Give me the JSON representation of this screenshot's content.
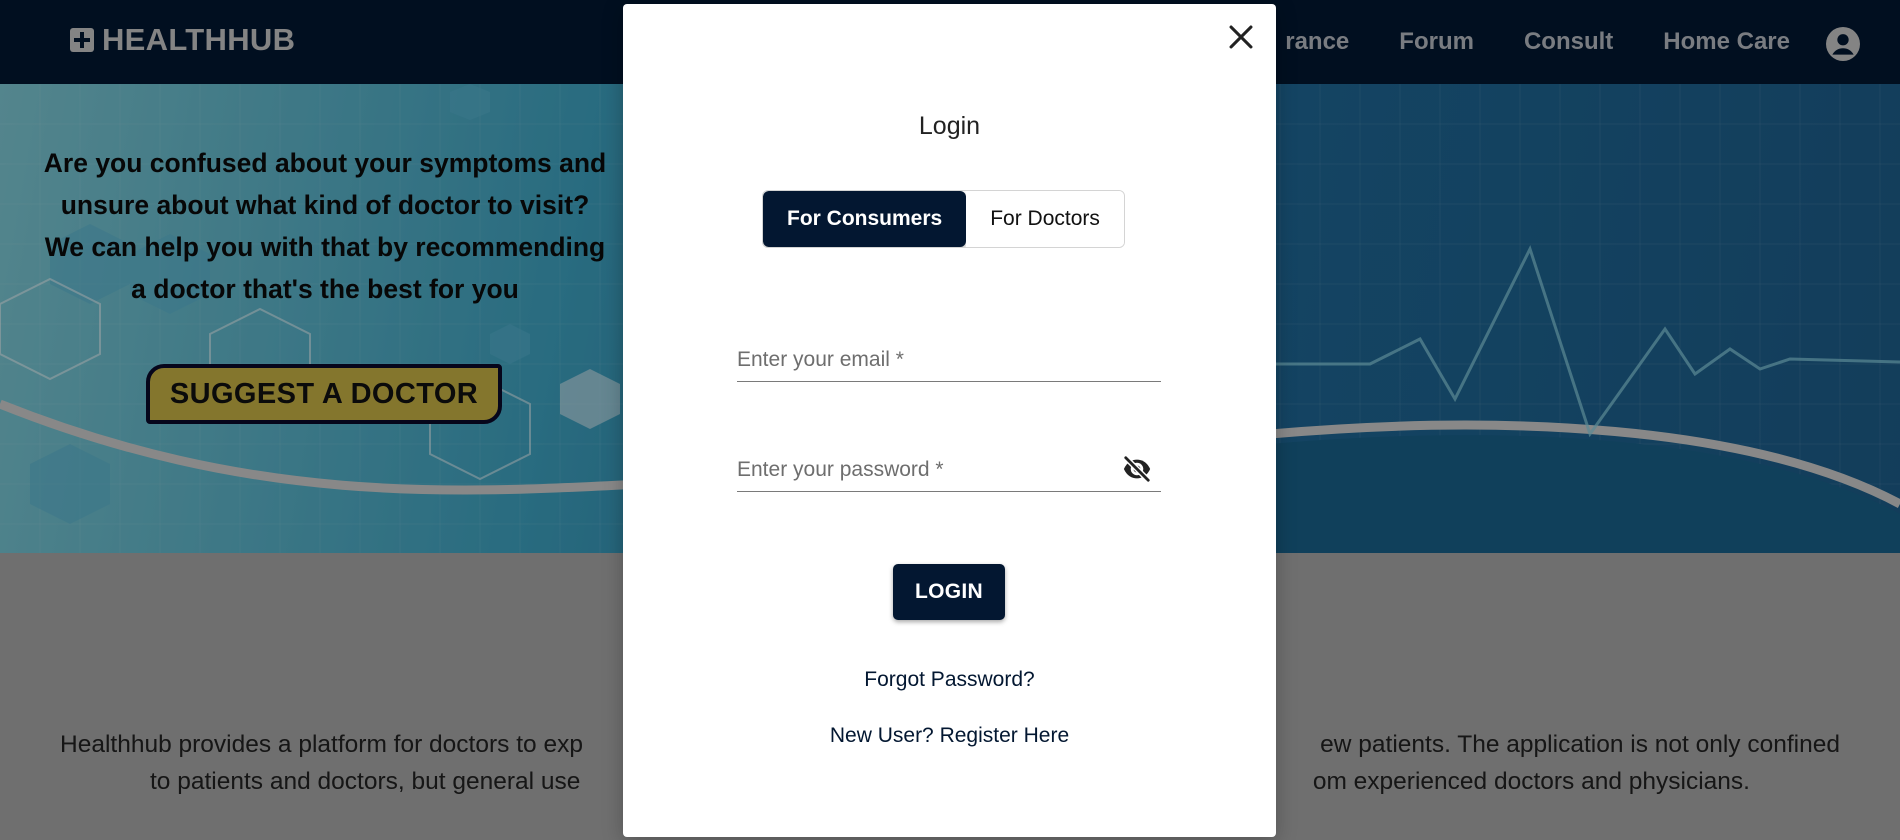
{
  "navbar": {
    "brand": "HEALTHHUB",
    "links": [
      "rance",
      "Forum",
      "Consult",
      "Home Care"
    ],
    "account_icon": "account-circle-icon"
  },
  "hero": {
    "lines": [
      "Are you confused about your symptoms and",
      "unsure about what kind of doctor to visit?",
      "We can help you with that by recommending",
      "a doctor that's the best for you"
    ],
    "suggest_button": "SUGGEST A DOCTOR"
  },
  "about": {
    "line1_left": "Healthhub provides a platform for doctors to exp",
    "line1_right": "ew patients. The application is not only confined",
    "line2_left": "to patients and doctors, but general use",
    "line2_right": "om experienced doctors and physicians."
  },
  "modal": {
    "title": "Login",
    "tabs": [
      "For Consumers",
      "For Doctors"
    ],
    "active_tab": "For Consumers",
    "email_placeholder": "Enter your email *",
    "password_placeholder": "Enter your password *",
    "login_button": "LOGIN",
    "forgot_password": "Forgot Password?",
    "register": "New User? Register Here"
  },
  "colors": {
    "navy": "#031731",
    "suggest_yellow": "#c9b445",
    "hero_blue": "#1f6a98"
  }
}
